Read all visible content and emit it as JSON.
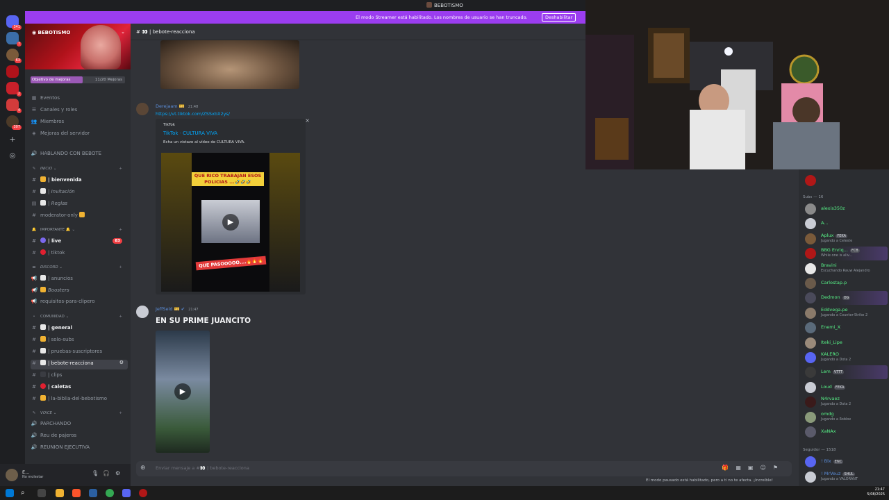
{
  "window": {
    "title": "BEBOTISMO"
  },
  "banner": {
    "message": "El modo Streamer está habilitado. Los nombres de usuario se han truncado.",
    "button": "Deshabilitar"
  },
  "rail": {
    "badges": [
      "341",
      "7",
      "63",
      "2",
      "4",
      "307"
    ]
  },
  "server": {
    "name": "BEBOTISMO",
    "boost_label": "Objetivo de mejoras",
    "boost_count": "11/20 Mejoras",
    "boost_progress": 0.55
  },
  "sidebar": {
    "top_items": [
      "Eventos",
      "Canales y roles",
      "Miembros",
      "Mejoras del servidor"
    ],
    "voice_top": "HABLANDO CON BEBOTE",
    "cat_inicio": "INICIO",
    "inicio": [
      "| bienvenida",
      "| Invitación",
      "| Reglas",
      "moderator-only"
    ],
    "cat_importante": "IMPORTANTE",
    "importante": [
      "| live",
      "| tiktok"
    ],
    "live_count": "83",
    "cat_discord": "DISCORD",
    "discord": [
      "| anuncios",
      "Boosters",
      "requisitos-para-clipero"
    ],
    "cat_comunidad": "COMUNIDAD",
    "comunidad": [
      "| general",
      "| solo-subs",
      "| pruebas-suscriptores",
      "| bebote-reacciona",
      "| clips",
      "| caletas",
      "| la-biblia-del-bebotismo"
    ],
    "cat_voice": "VOICE",
    "voice": [
      "PARCHANDO",
      "Reu de pajeros",
      "REUNION EJECUTIVA"
    ]
  },
  "user": {
    "name": "E...",
    "status": "No molestar"
  },
  "chat": {
    "channel": "| bebote-reacciona",
    "messages": [
      {
        "author": "Derejaam",
        "time": "21:48",
        "link": "https://vt.tiktok.com/ZSSxbX2ys/",
        "embed": {
          "provider": "TikTok",
          "title": "TikTok · CULTURA VIVA",
          "description": "Echa un vistazo al vídeo de CULTURA VIVA.",
          "overlay_top": "QUE RICO TRABAJAN ESOS POLICIAS ...🤣🤣🤣",
          "overlay_bottom": "QUE PASOOOOO....🔥🔥🔥"
        }
      },
      {
        "author": "JeffSeld",
        "time": "21:47",
        "text": "EN SU PRIME JUANCITO"
      }
    ],
    "composer_placeholder": "Enviar mensaje a #👀 | bebote-reacciona"
  },
  "members": {
    "subs_header": "Subs — 16",
    "subs": [
      {
        "name": "alexis350z",
        "status": ""
      },
      {
        "name": "A...",
        "status": ""
      },
      {
        "name": "Aplux",
        "tag": "FEKA",
        "status": "Jugando a Celeste"
      },
      {
        "name": "BBG Enriq...",
        "tag": "FCB",
        "status": "While one is aliv..."
      },
      {
        "name": "Bravini",
        "status": "Escuchando Rauw Alejandro"
      },
      {
        "name": "Carlostap.p",
        "status": ""
      },
      {
        "name": "Dedmon",
        "tag": "OG",
        "status": ""
      },
      {
        "name": "Eddvega.pe",
        "status": "Jugando a Counter-Strike 2"
      },
      {
        "name": "Enemi_X",
        "status": ""
      },
      {
        "name": "Iteki_Lipe",
        "status": ""
      },
      {
        "name": "KALERO",
        "status": "Jugando a Dota 2"
      },
      {
        "name": "Lem",
        "tag": "VTTT",
        "status": ""
      },
      {
        "name": "Loud",
        "tag": "FEKA",
        "status": ""
      },
      {
        "name": "N4rvaez",
        "status": "Jugando a Dota 2"
      },
      {
        "name": "omdg",
        "status": "Jugando a Roblox"
      },
      {
        "name": "XaNAx",
        "status": ""
      }
    ],
    "followers_header": "Seguidor — 1518",
    "followers": [
      {
        "name": "! Blx",
        "tag": "ENC",
        "status": ""
      },
      {
        "name": "! MrVeuz",
        "tag": "SHUL",
        "status": "Jugando a VALORANT"
      }
    ]
  },
  "notice": "El modo pausado está habilitado, pero a ti no te afecta. ¡Increíble!",
  "clock": {
    "time": "21:47",
    "date": "5/08/2025"
  }
}
